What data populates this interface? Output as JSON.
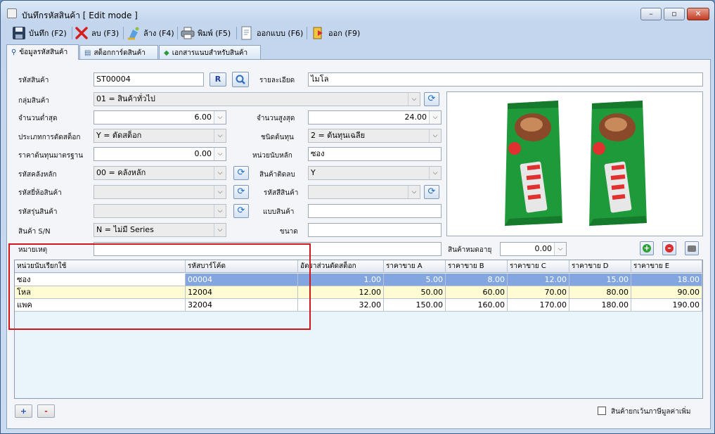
{
  "window": {
    "title": "บันทึกรหัสสินค้า [ Edit mode ]",
    "min": "–",
    "max": "▫",
    "close": "✕"
  },
  "toolbar": [
    {
      "label": "บันทึก (F2)",
      "icon": "floppy-icon"
    },
    {
      "label": "ลบ (F3)",
      "icon": "delete-x-icon"
    },
    {
      "label": "ล้าง (F4)",
      "icon": "clear-icon"
    },
    {
      "label": "พิมพ์ (F5)",
      "icon": "printer-icon"
    },
    {
      "label": "ออกแบบ (F6)",
      "icon": "design-icon"
    },
    {
      "label": "ออก (F9)",
      "icon": "exit-icon"
    }
  ],
  "tabs": [
    "ข้อมูลรหัสสินค้า",
    "สต็อกการ์ดสินค้า",
    "เอกสารแนบสำหรับสินค้า"
  ],
  "form": {
    "code_label": "รหัสสินค้า",
    "code_value": "ST00004",
    "r_button": "R",
    "desc_label": "รายละเอียด",
    "desc_value": "ไมโล",
    "group_label": "กลุ่มสินค้า",
    "group_value": "01 = สินค้าทั่วไป",
    "min_label": "จำนวนต่ำสุด",
    "min_value": "6.00",
    "max_label": "จำนวนสูงสุด",
    "max_value": "24.00",
    "stocktype_label": "ประเภทการตัดสต็อก",
    "stocktype_value": "Y = ตัดสต็อก",
    "costtype_label": "ชนิดต้นทุน",
    "costtype_value": "2 = ต้นทุนเฉลีย",
    "stdcost_label": "ราคาต้นทุนมาตรฐาน",
    "stdcost_value": "0.00",
    "unit_label": "หน่วยนับหลัก",
    "unit_value": "ซอง",
    "warehouse_label": "รหัสคลังหลัก",
    "warehouse_value": "00 = คลังหลัก",
    "negative_label": "สินค้าติดลบ",
    "negative_value": "Y",
    "brand_label": "รหัสยี่ห้อสินค้า",
    "brand_value": "",
    "color_label": "รหัสสีสินค้า",
    "color_value": "",
    "model_label": "รหัสรุ่นสินค้า",
    "model_value": "",
    "pattern_label": "แบบสินค้า",
    "pattern_value": "",
    "sn_label": "สินค้า S/N",
    "sn_value": "N = ไม่มี Series",
    "size_label": "ขนาด",
    "size_value": "",
    "remark_label": "หมายเหตุ",
    "remark_value": "",
    "expire_label": "สินค้าหมดอายุ",
    "expire_value": "0.00"
  },
  "grid": {
    "headers": [
      "หน่วยนับเรียกใช้",
      "รหัสบาร์โค้ด",
      "อัตราส่วนตัดสต็อก",
      "ราคาขาย A",
      "ราคาขาย B",
      "ราคาขาย C",
      "ราคาขาย D",
      "ราคาขาย E"
    ],
    "rows": [
      [
        "ซอง",
        "00004",
        "1.00",
        "5.00",
        "8.00",
        "12.00",
        "15.00",
        "18.00"
      ],
      [
        "โหล",
        "12004",
        "12.00",
        "50.00",
        "60.00",
        "70.00",
        "80.00",
        "90.00"
      ],
      [
        "แพค",
        "32004",
        "32.00",
        "150.00",
        "160.00",
        "170.00",
        "180.00",
        "190.00"
      ]
    ]
  },
  "footer": {
    "add": "+",
    "remove": "-",
    "vat_exempt_label": "สินค้ายกเว้นภาษีมูลค่าเพิ่ม"
  },
  "colors": {
    "selected_row": "#84a6e0",
    "highlight_row": "#fffbd2",
    "red_box": "#d2171b",
    "milo_green": "#1f9a3a"
  }
}
